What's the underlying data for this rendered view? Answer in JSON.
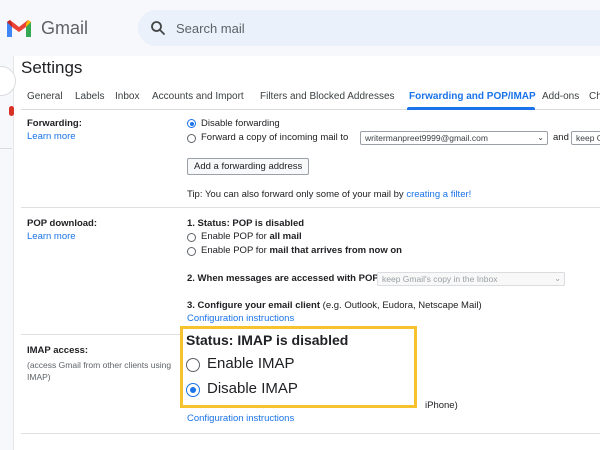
{
  "app": {
    "brand": "Gmail"
  },
  "search": {
    "placeholder": "Search mail"
  },
  "page": {
    "title": "Settings"
  },
  "tabs": [
    {
      "label": "General"
    },
    {
      "label": "Labels"
    },
    {
      "label": "Inbox"
    },
    {
      "label": "Accounts and Import"
    },
    {
      "label": "Filters and Blocked Addresses"
    },
    {
      "label": "Forwarding and POP/IMAP",
      "active": true
    },
    {
      "label": "Add-ons"
    },
    {
      "label": "Chat"
    }
  ],
  "forwarding": {
    "label": "Forwarding:",
    "learn_more": "Learn more",
    "option_disable": "Disable forwarding",
    "option_forward": "Forward a copy of incoming mail to",
    "email_select": "writermanpreet9999@gmail.com",
    "and_text": "and",
    "keep_select": "keep Gmail's copy",
    "add_button": "Add a forwarding address",
    "tip_prefix": "Tip: You can also forward only some of your mail by",
    "tip_link": "creating a filter!"
  },
  "pop": {
    "label": "POP download:",
    "learn_more": "Learn more",
    "status": "1. Status: POP is disabled",
    "enable_all_prefix": "Enable POP for",
    "enable_all_bold": "all mail",
    "enable_new_prefix": "Enable POP for",
    "enable_new_bold": "mail that arrives from now on",
    "when_accessed": "2. When messages are accessed with POP",
    "when_select": "keep Gmail's copy in the Inbox",
    "configure_bold": "3. Configure your email client",
    "configure_rest": "(e.g. Outlook, Eudora, Netscape Mail)",
    "config_link": "Configuration instructions"
  },
  "imap": {
    "label": "IMAP access:",
    "description": "(access Gmail from other clients using IMAP)",
    "status": "Status: IMAP is disabled",
    "enable": "Enable IMAP",
    "disable": "Disable IMAP",
    "partial_text": "iPhone)",
    "config_link": "Configuration instructions"
  },
  "colors": {
    "accent": "#1a73e8",
    "highlight": "#f6c32e"
  },
  "selection": {
    "forwarding": "disable",
    "pop": "none",
    "imap": "disable"
  }
}
